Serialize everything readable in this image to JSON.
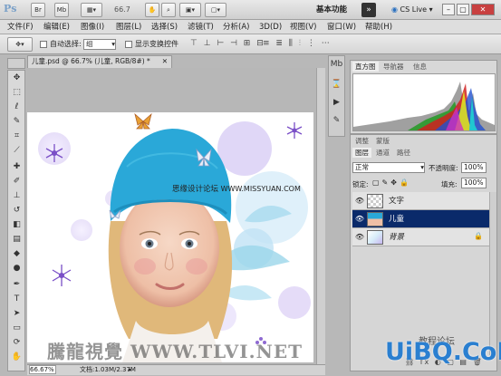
{
  "app": {
    "logo": "Ps",
    "zoom_display": "66.7",
    "workspace_label": "基本功能",
    "cs_live": "CS Live"
  },
  "menu": [
    "文件(F)",
    "编辑(E)",
    "图像(I)",
    "图层(L)",
    "选择(S)",
    "滤镜(T)",
    "分析(A)",
    "3D(D)",
    "视图(V)",
    "窗口(W)",
    "帮助(H)"
  ],
  "options": {
    "auto_select_label": "自动选择:",
    "auto_select_value": "组",
    "show_transform_label": "显示变换控件"
  },
  "document": {
    "tab_title": "儿童.psd @ 66.7% (儿童, RGB/8#) *",
    "status_zoom": "66.67%",
    "status_doc": "文档:1.03M/2.37M"
  },
  "panels": {
    "histogram_tabs": [
      "直方图",
      "导航器",
      "信息"
    ],
    "layer_tabs_top": [
      "调整",
      "蒙版"
    ],
    "layer_tabs": [
      "图层",
      "通道",
      "路径"
    ],
    "blend_mode": "正常",
    "opacity_label": "不透明度:",
    "opacity_value": "100%",
    "lock_label": "锁定:",
    "fill_label": "填充:",
    "fill_value": "100%",
    "layers": [
      {
        "name": "文字",
        "selected": false
      },
      {
        "name": "儿童",
        "selected": true
      },
      {
        "name": "背景",
        "selected": false
      }
    ]
  },
  "watermarks": {
    "canvas_text": "思缘设计论坛",
    "canvas_url": "WWW.MISSYUAN.COM",
    "bottom_brand": "騰龍視覺 WWW.TLVI.NET",
    "uibq": "UiBQ.CoM",
    "uibq_small": "教程论坛"
  },
  "colors": {
    "selected_layer": "#0a2a6a",
    "hat": "#2aa8d8"
  }
}
